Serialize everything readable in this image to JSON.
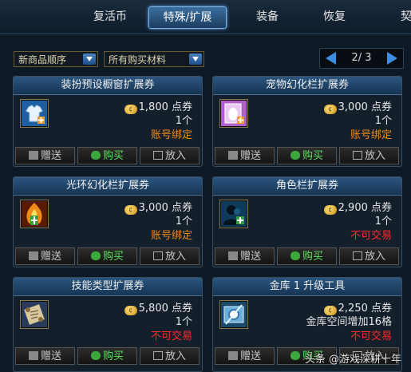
{
  "tabs": [
    {
      "label": "复活币",
      "active": false
    },
    {
      "label": "特殊/扩展",
      "active": true
    },
    {
      "label": "装备",
      "active": false
    },
    {
      "label": "恢复",
      "active": false
    },
    {
      "label": "契",
      "active": false
    }
  ],
  "filters": {
    "sort": "新商品顺序",
    "material": "所有购买材料"
  },
  "pager": {
    "text": "2/ 3"
  },
  "items": [
    {
      "title": "装扮预设橱窗扩展券",
      "icon": "clothing-icon",
      "price": "1,800 点券",
      "qty": "1个",
      "status": "账号绑定",
      "status_color": "#f08a1c"
    },
    {
      "title": "宠物幻化栏扩展券",
      "icon": "pet-ticket-icon",
      "price": "3,000 点券",
      "qty": "1个",
      "status": "账号绑定",
      "status_color": "#f08a1c"
    },
    {
      "title": "光环幻化栏扩展券",
      "icon": "aura-icon",
      "price": "3,000 点券",
      "qty": "1个",
      "status": "账号绑定",
      "status_color": "#f08a1c"
    },
    {
      "title": "角色栏扩展券",
      "icon": "character-slot-icon",
      "price": "2,900 点券",
      "qty": "1个",
      "status": "不可交易",
      "status_color": "#ff2a2a"
    },
    {
      "title": "技能类型扩展券",
      "icon": "skill-scroll-icon",
      "price": "5,800 点券",
      "qty": "1个",
      "status": "不可交易",
      "status_color": "#ff2a2a"
    },
    {
      "title": "金库 1 升级工具",
      "icon": "vault-upgrade-icon",
      "price": "2,250 点券",
      "qty": "金库空间增加16格",
      "status": "不可交易",
      "status_color": "#ff2a2a"
    }
  ],
  "actions": {
    "gift": "赠送",
    "buy": "购买",
    "put": "放入"
  },
  "coin_label": "cera",
  "watermark": "头条 @游戏深耕十年"
}
